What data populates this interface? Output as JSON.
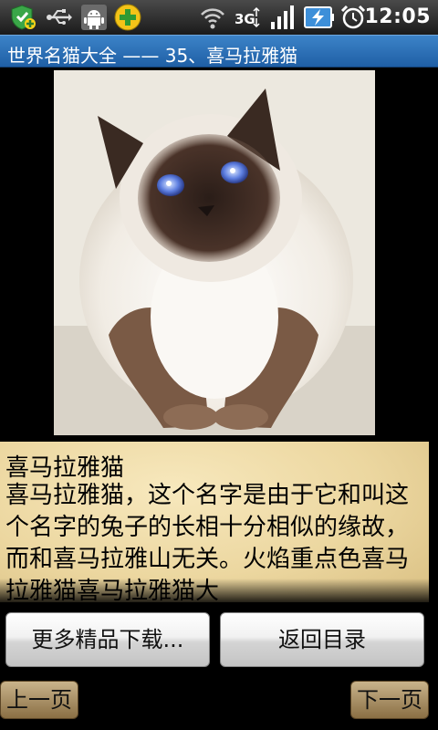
{
  "status_bar": {
    "time": "12:05",
    "icons": [
      "shield-plus-icon",
      "usb-icon",
      "android-debug-icon",
      "plus-app-icon",
      "wifi-icon",
      "3g-icon",
      "signal-icon",
      "battery-charging-icon",
      "alarm-icon"
    ]
  },
  "title_bar": {
    "title": "世界名猫大全 —— 35、喜马拉雅猫"
  },
  "content": {
    "heading": "喜马拉雅猫",
    "body": "喜马拉雅猫，这个名字是由于它和叫这个名字的兔子的长相十分相似的缘故，而和喜马拉雅山无关。火焰重点色喜马拉雅猫喜马拉雅猫大"
  },
  "buttons": {
    "more_downloads": "更多精品下载...",
    "back_to_index": "返回目录",
    "prev_page": "上一页",
    "next_page": "下一页"
  },
  "colors": {
    "title_bar": "#2a6fb5",
    "text_background": "#ecd7a0",
    "nav_button": "#a68a5c"
  }
}
